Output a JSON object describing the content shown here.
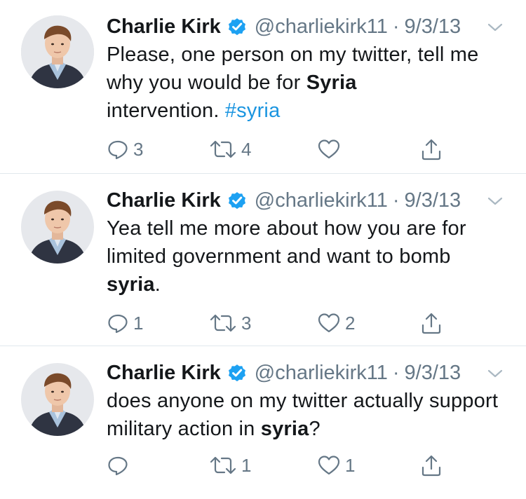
{
  "tweets": [
    {
      "author": {
        "name": "Charlie Kirk",
        "handle": "@charliekirk11",
        "verified": true
      },
      "separator": "·",
      "date": "9/3/13",
      "text_segments": [
        {
          "text": "Please, one person on my twitter, tell me why you would be for ",
          "style": "normal"
        },
        {
          "text": "Syria",
          "style": "bold"
        },
        {
          "text": " intervention.  ",
          "style": "normal"
        },
        {
          "text": "#syria",
          "style": "hashtag"
        }
      ],
      "actions": {
        "reply_count": "3",
        "retweet_count": "4",
        "like_count": "",
        "liked": false
      }
    },
    {
      "author": {
        "name": "Charlie Kirk",
        "handle": "@charliekirk11",
        "verified": true
      },
      "separator": "·",
      "date": "9/3/13",
      "text_segments": [
        {
          "text": "Yea tell me more about how you are for limited government and want to bomb ",
          "style": "normal"
        },
        {
          "text": "syria",
          "style": "bold"
        },
        {
          "text": ".",
          "style": "normal"
        }
      ],
      "actions": {
        "reply_count": "1",
        "retweet_count": "3",
        "like_count": "2",
        "liked": false
      }
    },
    {
      "author": {
        "name": "Charlie Kirk",
        "handle": "@charliekirk11",
        "verified": true
      },
      "separator": "·",
      "date": "9/3/13",
      "text_segments": [
        {
          "text": "does anyone on my twitter actually support military action in ",
          "style": "normal"
        },
        {
          "text": "syria",
          "style": "bold"
        },
        {
          "text": "?",
          "style": "normal"
        }
      ],
      "actions": {
        "reply_count": "",
        "retweet_count": "1",
        "like_count": "1",
        "liked": false
      }
    }
  ],
  "colors": {
    "text": "#14171a",
    "secondary": "#657786",
    "link": "#1b95e0",
    "verified": "#1da1f2",
    "divider": "#e1e8ed"
  },
  "icons": {
    "verified": "verified-badge-icon",
    "caret": "chevron-down-icon",
    "reply": "reply-icon",
    "retweet": "retweet-icon",
    "like": "heart-icon",
    "share": "share-icon"
  }
}
